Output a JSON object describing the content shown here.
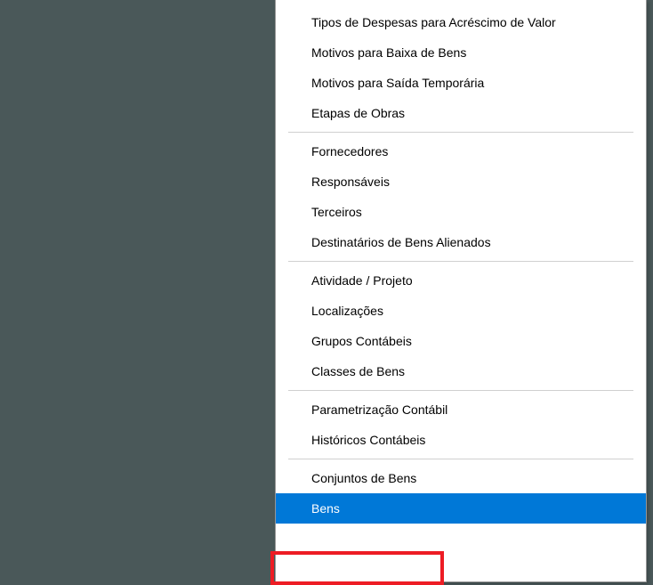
{
  "menu": {
    "groups": [
      {
        "items": [
          {
            "label": "Tipos de Despesas para Acréscimo de Valor",
            "selected": false
          },
          {
            "label": "Motivos para Baixa de Bens",
            "selected": false
          },
          {
            "label": "Motivos para Saída Temporária",
            "selected": false
          },
          {
            "label": "Etapas de Obras",
            "selected": false
          }
        ]
      },
      {
        "items": [
          {
            "label": "Fornecedores",
            "selected": false
          },
          {
            "label": "Responsáveis",
            "selected": false
          },
          {
            "label": "Terceiros",
            "selected": false
          },
          {
            "label": "Destinatários de Bens Alienados",
            "selected": false
          }
        ]
      },
      {
        "items": [
          {
            "label": "Atividade / Projeto",
            "selected": false
          },
          {
            "label": "Localizações",
            "selected": false
          },
          {
            "label": "Grupos Contábeis",
            "selected": false
          },
          {
            "label": "Classes de Bens",
            "selected": false
          }
        ]
      },
      {
        "items": [
          {
            "label": "Parametrização Contábil",
            "selected": false
          },
          {
            "label": "Históricos Contábeis",
            "selected": false
          }
        ]
      },
      {
        "items": [
          {
            "label": "Conjuntos de Bens",
            "selected": false
          },
          {
            "label": "Bens",
            "selected": true
          }
        ]
      }
    ]
  }
}
